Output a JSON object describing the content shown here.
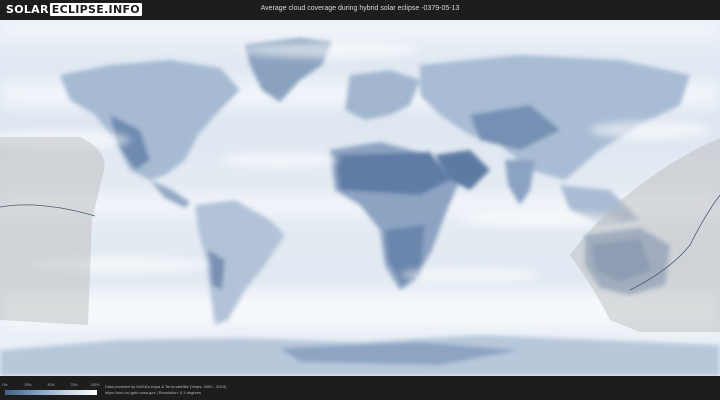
{
  "header": {
    "logo_part1": "SOLAR",
    "logo_part2": "ECLIPSE.INFO",
    "title": "Average cloud coverage during hybrid solar eclipse -0379-05-13"
  },
  "legend": {
    "ticks": [
      "0%",
      "25%",
      "50%",
      "75%",
      "100%"
    ],
    "gradient": [
      "#3f5f86",
      "#7f9dbf",
      "#c5d4e4",
      "#ffffff"
    ]
  },
  "credits": {
    "line1": "Data provided by NASA's Aqua & Terra satellite (Years: 2000 - 2019)",
    "line2": "https://neo.sci.gsfc.nasa.gov | Resolution: 0.1 degrees"
  },
  "colors": {
    "cloud": "#eef3f8",
    "land_clear": "#6d89ad",
    "night_shadow": "#b7b7b7"
  }
}
